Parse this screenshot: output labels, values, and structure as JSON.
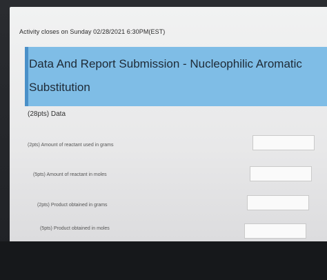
{
  "activity": {
    "deadline_text": "Activity closes on Sunday 02/28/2021 6:30PM(EST)"
  },
  "banner": {
    "title": "Data And Report Submission - Nucleophilic Aromatic Substitution"
  },
  "section": {
    "label": "(28pts) Data"
  },
  "questions": [
    {
      "label": "(2pts)  Amount of reactant used in grams",
      "value": ""
    },
    {
      "label": "(5pts)  Amount of reactant in moles",
      "value": ""
    },
    {
      "label": "(2pts)  Product obtained in grams",
      "value": ""
    },
    {
      "label": "(5pts)  Product obtained in moles",
      "value": ""
    }
  ],
  "colors": {
    "banner": "#7fbde6",
    "banner_accent": "#4a90c8",
    "page_bg": "#eeeeef",
    "bezel": "#1c1e22"
  }
}
